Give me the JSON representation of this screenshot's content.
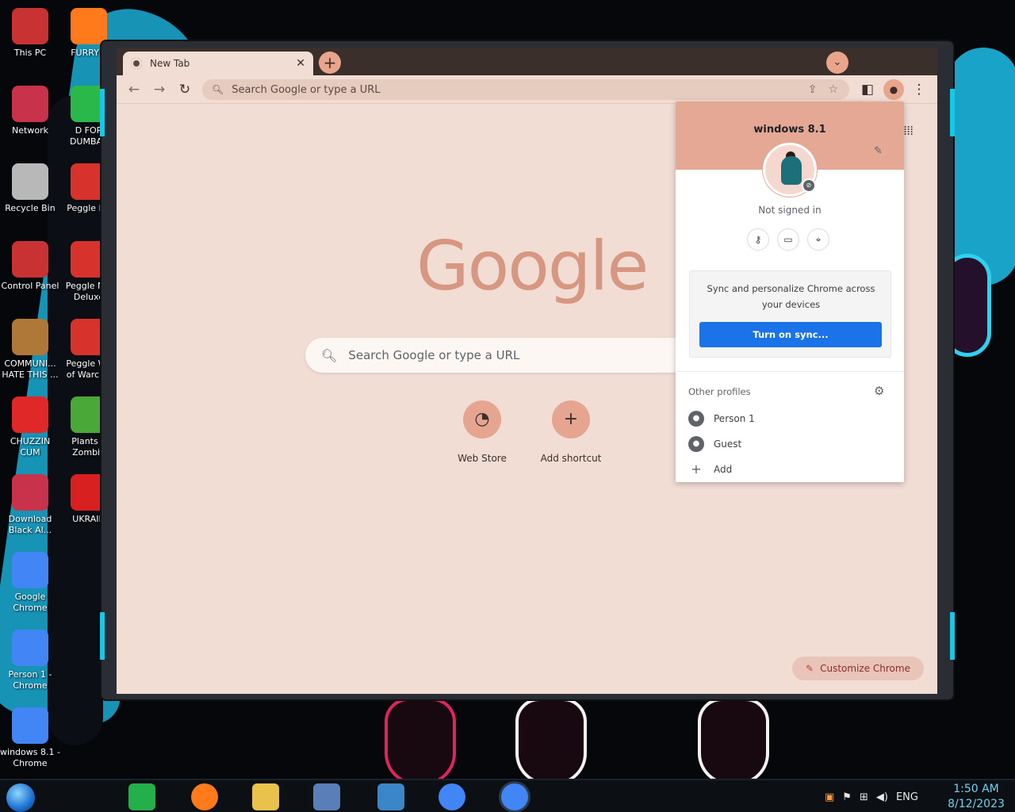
{
  "desktop": {
    "icons": [
      {
        "label": "This PC",
        "color": "#c83232"
      },
      {
        "label": "FURRY F",
        "color": "#ff7a1a"
      },
      {
        "label": "Network",
        "color": "#c8324b"
      },
      {
        "label": "D FOR\nDUMBAS",
        "color": "#2bb84a"
      },
      {
        "label": "Recycle Bin",
        "color": "#b8b8b8"
      },
      {
        "label": "Peggle De",
        "color": "#d8322c"
      },
      {
        "label": "Control Panel",
        "color": "#c83232"
      },
      {
        "label": "Peggle Nig\nDeluxe",
        "color": "#d8322c"
      },
      {
        "label": "COMMUNI...\nHATE THIS ...",
        "color": "#b07838"
      },
      {
        "label": "Peggle Wo\nof Warcraf",
        "color": "#d8322c"
      },
      {
        "label": "CHUZZIN\nCUM",
        "color": "#e02828"
      },
      {
        "label": "Plants v\nZombie",
        "color": "#4aa838"
      },
      {
        "label": "Download\nBlack Al...",
        "color": "#c8324b"
      },
      {
        "label": "UKRAIN",
        "color": "#d82020"
      },
      {
        "label": "Google\nChrome",
        "color": "#4285f4"
      },
      {
        "label": "Person 1 -\nChrome",
        "color": "#4285f4"
      },
      {
        "label": "windows 8.1 -\nChrome",
        "color": "#4285f4"
      }
    ]
  },
  "browser": {
    "tab_title": "New Tab",
    "tab_close": "✕",
    "new_tab": "+",
    "tab_search": "⌄",
    "omnibox_placeholder": "Search Google or type a URL",
    "logo_text": "Google",
    "search_placeholder": "Search Google or type a URL",
    "shortcuts": [
      {
        "label": "Web Store",
        "glyph": "◔"
      },
      {
        "label": "Add shortcut",
        "glyph": "+"
      }
    ],
    "customize_label": "Customize Chrome"
  },
  "profile_popup": {
    "name": "windows 8.1",
    "status": "Not signed in",
    "sync_message": "Sync and personalize Chrome across your devices",
    "sync_button": "Turn on sync...",
    "other_profiles_title": "Other profiles",
    "profiles": [
      {
        "label": "Person 1",
        "glyph": "●"
      },
      {
        "label": "Guest",
        "glyph": "●"
      },
      {
        "label": "Add",
        "glyph": "+"
      }
    ]
  },
  "taskbar": {
    "language": "ENG",
    "time": "1:50 AM",
    "date": "8/12/2023"
  }
}
